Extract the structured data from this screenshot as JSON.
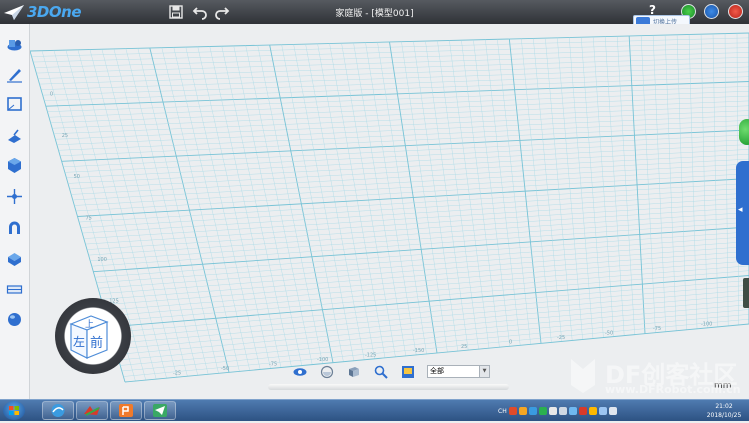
{
  "app": {
    "logo_text": "3DOne",
    "document_title": "家庭版 - [模型001]",
    "help_label": "?",
    "cloud_upload_label": "切换上传"
  },
  "toolbar": {
    "icons": [
      "save-icon",
      "undo-icon",
      "redo-icon"
    ]
  },
  "left_toolbar": {
    "tools": [
      "basic-solid-icon",
      "sketch-icon",
      "sketch-edit-icon",
      "special-feature-icon",
      "feature-modify-icon",
      "basic-edit-icon",
      "magnet-icon",
      "combine-icon",
      "distance-measure-icon",
      "material-ball-icon"
    ]
  },
  "grid": {
    "tick_labels": [
      "0",
      "25",
      "50",
      "75",
      "100",
      "125",
      "150",
      "-25",
      "-50",
      "-75",
      "-100",
      "-125",
      "-150",
      "25",
      "0",
      "-25",
      "-50",
      "-75",
      "-100"
    ]
  },
  "view_cube": {
    "top_face": "上",
    "front_face": "前",
    "left_face": "左"
  },
  "view_bar": {
    "icons": [
      "eye-icon",
      "view-shade-icon",
      "wireframe-icon",
      "zoom-icon",
      "render-icon"
    ],
    "filter_value": "全部"
  },
  "units": {
    "label": "mm"
  },
  "watermark": {
    "text": "DF创客社区",
    "url": "www.DFRobot.com.cn"
  },
  "taskbar": {
    "apps": [
      "start-button",
      "browser",
      "3done",
      "pdf-app",
      "telegram"
    ],
    "ime_label": "CH",
    "time": "21:02",
    "date": "2018/10/25"
  },
  "colors": {
    "accent": "#2f6fcf",
    "grid_major": "#77c3d6",
    "grid_minor": "#a9dbe7",
    "titlebar": "#3c4046"
  }
}
